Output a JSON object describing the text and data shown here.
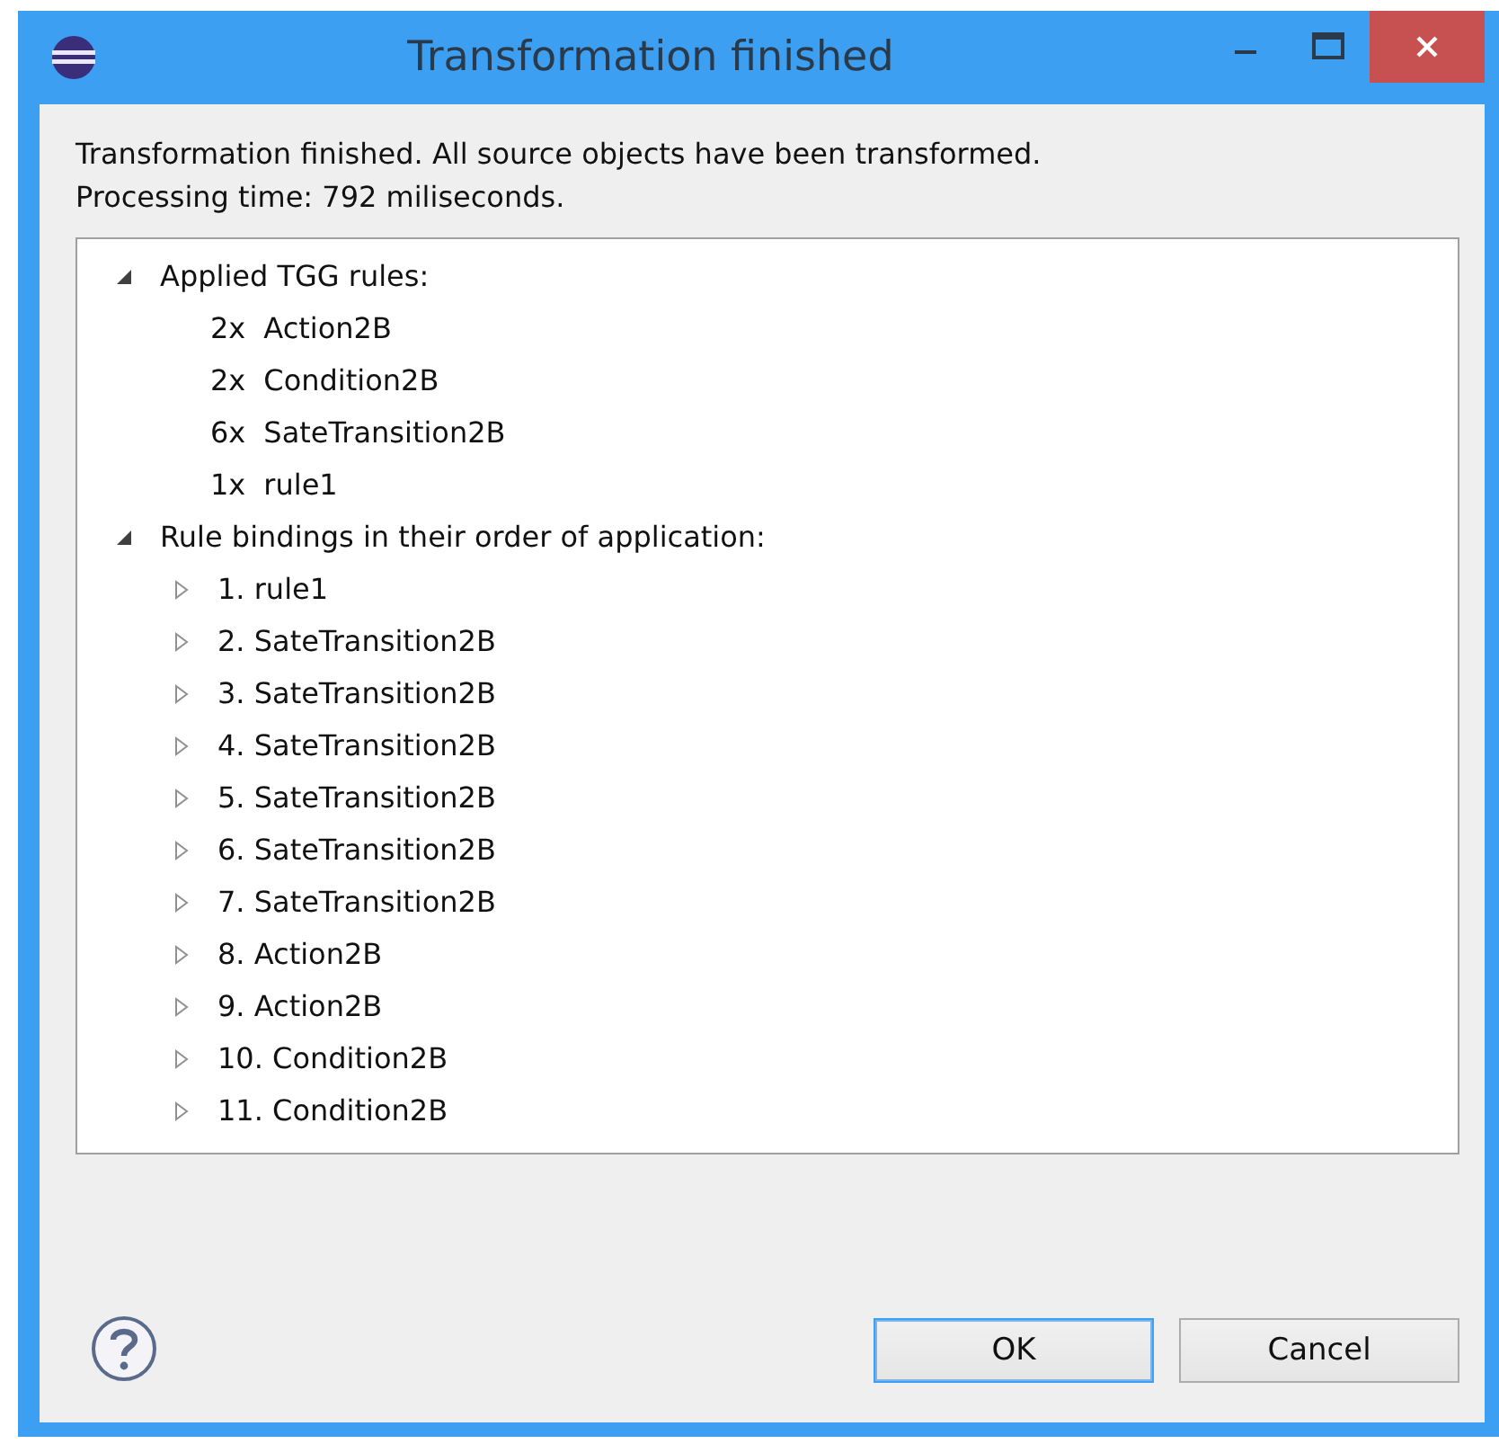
{
  "window": {
    "title": "Transformation finished"
  },
  "message": [
    "Transformation finished. All source objects have been transformed.",
    "Processing time: 792 miliseconds."
  ],
  "tree": [
    {
      "label": "Applied TGG rules:",
      "expanded": true,
      "children": [
        {
          "count": "2x",
          "label": "Action2B"
        },
        {
          "count": "2x",
          "label": "Condition2B"
        },
        {
          "count": "6x",
          "label": "SateTransition2B"
        },
        {
          "count": "1x",
          "label": "rule1"
        }
      ]
    },
    {
      "label": "Rule bindings in their order of application:",
      "expanded": true,
      "children": [
        {
          "label": "1. rule1",
          "expanded": false
        },
        {
          "label": "2. SateTransition2B",
          "expanded": false
        },
        {
          "label": "3. SateTransition2B",
          "expanded": false
        },
        {
          "label": "4. SateTransition2B",
          "expanded": false
        },
        {
          "label": "5. SateTransition2B",
          "expanded": false
        },
        {
          "label": "6. SateTransition2B",
          "expanded": false
        },
        {
          "label": "7. SateTransition2B",
          "expanded": false
        },
        {
          "label": "8. Action2B",
          "expanded": false
        },
        {
          "label": "9. Action2B",
          "expanded": false
        },
        {
          "label": "10. Condition2B",
          "expanded": false
        },
        {
          "label": "11. Condition2B",
          "expanded": false
        }
      ]
    }
  ],
  "buttons": [
    {
      "label": "OK",
      "default": true
    },
    {
      "label": "Cancel",
      "default": false
    }
  ]
}
